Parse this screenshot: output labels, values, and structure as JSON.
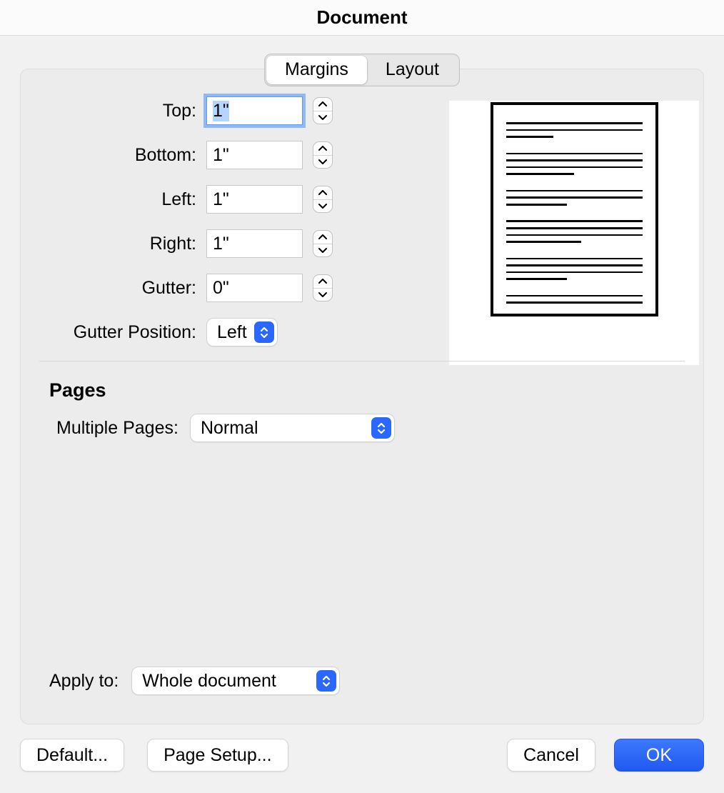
{
  "dialog": {
    "title": "Document"
  },
  "tabs": {
    "margins": "Margins",
    "layout": "Layout",
    "active": "margins"
  },
  "margins": {
    "top": {
      "label": "Top:",
      "value": "1\""
    },
    "bottom": {
      "label": "Bottom:",
      "value": "1\""
    },
    "left": {
      "label": "Left:",
      "value": "1\""
    },
    "right": {
      "label": "Right:",
      "value": "1\""
    },
    "gutter": {
      "label": "Gutter:",
      "value": "0\""
    },
    "gutter_position": {
      "label": "Gutter Position:",
      "value": "Left"
    }
  },
  "pages": {
    "heading": "Pages",
    "multiple_pages": {
      "label": "Multiple Pages:",
      "value": "Normal"
    }
  },
  "apply_to": {
    "label": "Apply to:",
    "value": "Whole document"
  },
  "buttons": {
    "default": "Default...",
    "page_setup": "Page Setup...",
    "cancel": "Cancel",
    "ok": "OK"
  }
}
